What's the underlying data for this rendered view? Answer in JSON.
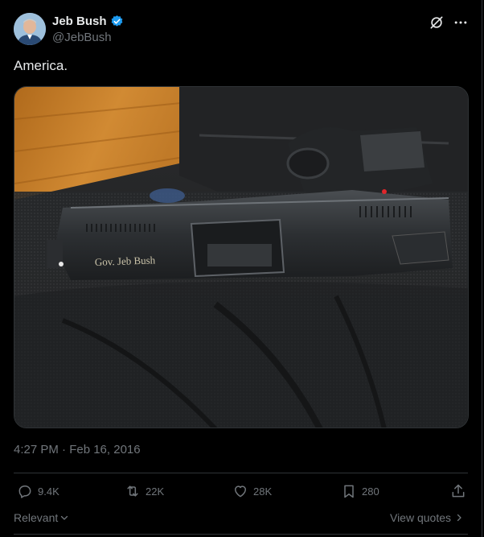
{
  "author": {
    "name": "Jeb Bush",
    "handle": "@JebBush",
    "verified": true
  },
  "tweet": {
    "text": "America.",
    "engraving": "Gov. Jeb Bush",
    "timestamp": "4:27 PM · Feb 16, 2016"
  },
  "actions": {
    "replies": "9.4K",
    "reposts": "22K",
    "likes": "28K",
    "bookmarks": "280"
  },
  "footer": {
    "sort_label": "Relevant",
    "view_quotes_label": "View quotes"
  },
  "colors": {
    "background": "#000000",
    "text_primary": "#e7e9ea",
    "text_secondary": "#71767b",
    "verified_blue": "#1d9bf0",
    "border": "#2f3336"
  }
}
